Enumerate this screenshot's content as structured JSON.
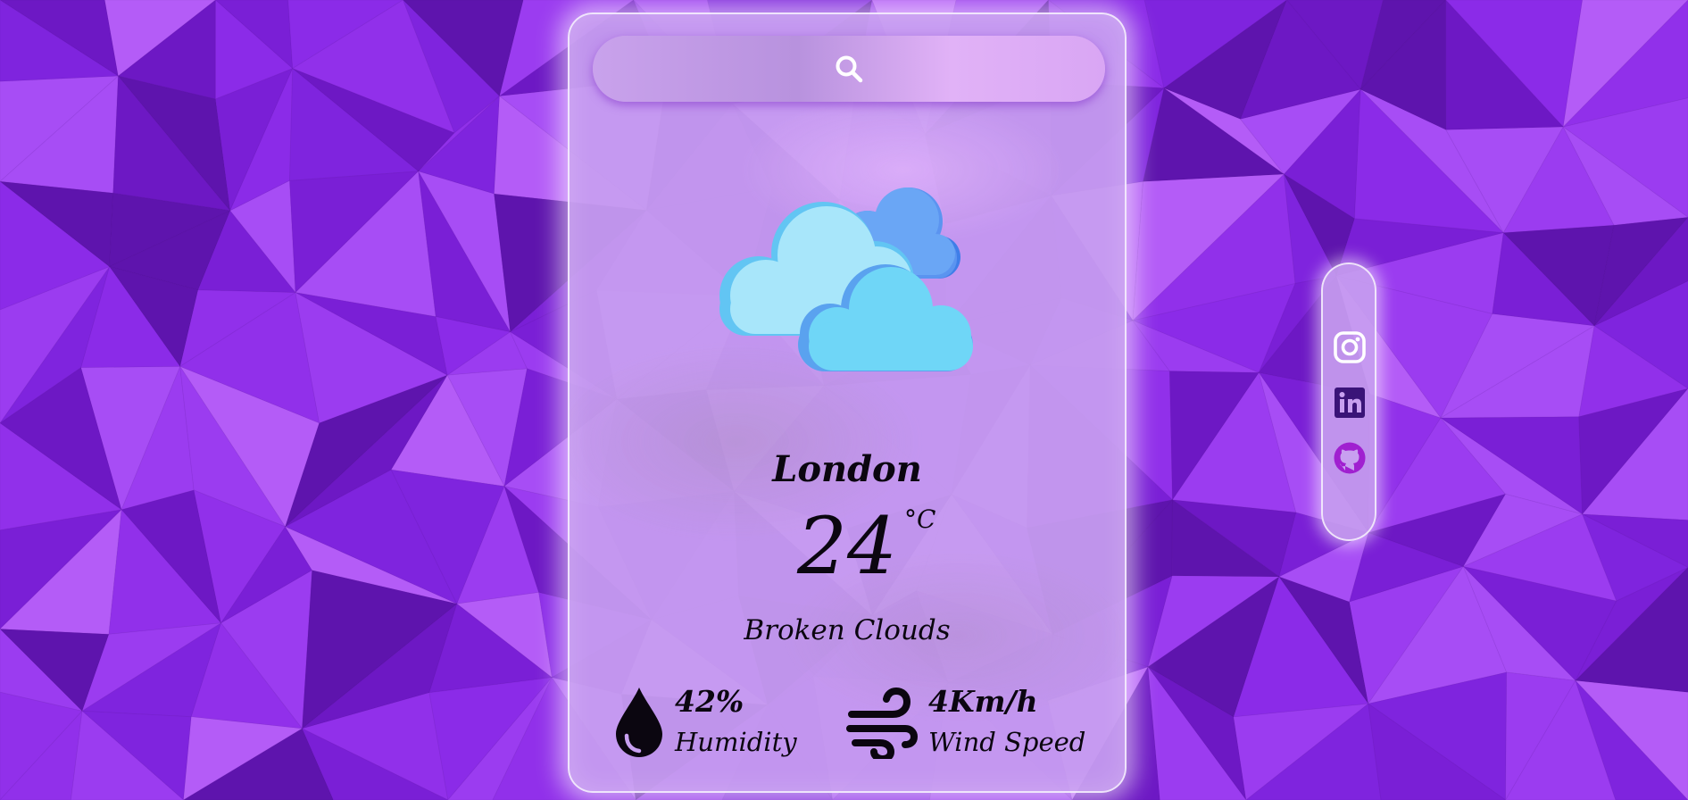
{
  "search": {
    "value": "",
    "placeholder": ""
  },
  "weather": {
    "icon": "broken-clouds-icon",
    "city": "London",
    "temperature": "24",
    "unit": "°C",
    "description": "Broken Clouds"
  },
  "stats": {
    "humidity": {
      "value": "42%",
      "label": "Humidity",
      "icon": "water-drop-icon"
    },
    "wind": {
      "value": "4Km/h",
      "label": "Wind Speed",
      "icon": "wind-icon"
    }
  },
  "social": [
    {
      "name": "Instagram",
      "icon": "instagram-icon"
    },
    {
      "name": "LinkedIn",
      "icon": "linkedin-icon"
    },
    {
      "name": "GitHub",
      "icon": "github-icon"
    }
  ],
  "colors": {
    "background": "#8a2be2",
    "card": "#c8a0f0",
    "cloud_light": "#a8e6fa",
    "cloud_mid": "#6fd6f7",
    "cloud_back": "#6aa6f5",
    "linkedin": "#3a1478",
    "github": "#a020d0",
    "text": "#0b0610"
  }
}
